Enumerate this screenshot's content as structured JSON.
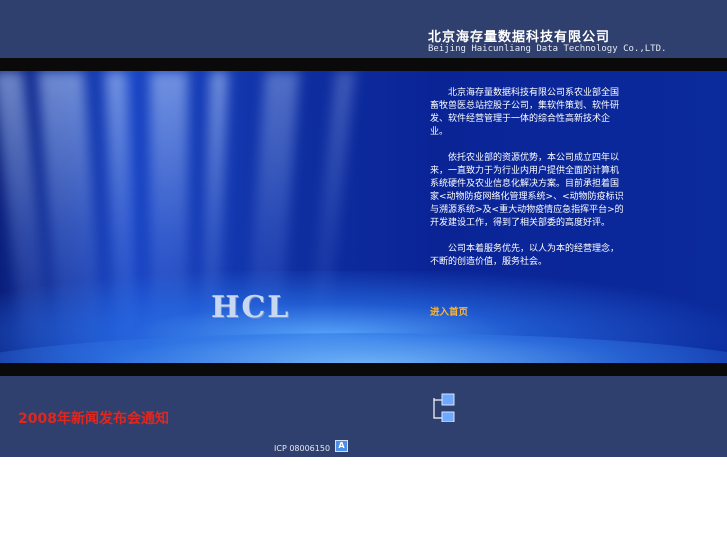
{
  "header": {
    "company_name_cn": "北京海存量数据科技有限公司",
    "company_name_en": "Beijing Haicunliang Data Technology Co.,LTD."
  },
  "hero": {
    "logo_text": "HCL",
    "intro_paragraphs": [
      "北京海存量数据科技有限公司系农业部全国畜牧兽医总站控股子公司，集软件策划、软件研发、软件经营管理于一体的综合性高新技术企业。",
      "依托农业部的资源优势，本公司成立四年以来，一直致力于为行业内用户提供全面的计算机系统硬件及农业信息化解决方案。目前承担着国家<动物防疫网络化管理系统>、<动物防疫标识与溯源系统>及<重大动物疫情应急指挥平台>的开发建设工作，得到了相关部委的高度好评。",
      "公司本着服务优先，以人为本的经营理念，不断的创造价值，服务社会。"
    ],
    "enter_link": "进入首页"
  },
  "footer": {
    "news_link": "2008年新闻发布会通知",
    "icp_text": "ICP 08006150",
    "icp_badge": "A"
  },
  "colors": {
    "header_bg": "#2f3f6e",
    "band": "#0a0a0a",
    "hero_blue": "#0e2d9f",
    "link_orange": "#ffb42a",
    "news_red": "#e2261c"
  }
}
